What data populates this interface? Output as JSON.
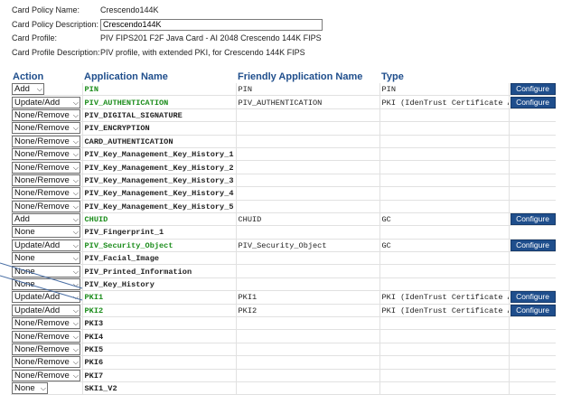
{
  "policy": {
    "name_label": "Card Policy Name:",
    "name_value": "Crescendo144K",
    "desc_label": "Card Policy Description:",
    "desc_value": "Crescendo144K",
    "profile_label": "Card Profile:",
    "profile_value": "PIV FIPS201 F2F Java Card - AI 2048 Crescendo 144K FIPS",
    "profile_desc_label": "Card Profile Description:",
    "profile_desc_value": "PIV profile, with extended PKI, for Crescendo 144K FIPS"
  },
  "table": {
    "headers": {
      "action": "Action",
      "app_name": "Application Name",
      "friendly": "Friendly Application Name",
      "type": "Type"
    },
    "configure_label": "Configure",
    "rows": [
      {
        "action": "Add",
        "name": "PIN",
        "green": true,
        "friendly": "PIN",
        "type": "PIN",
        "configure": true
      },
      {
        "action": "Update/Add",
        "name": "PIV_AUTHENTICATION",
        "green": true,
        "friendly": "PIV_AUTHENTICATION",
        "type": "PKI (IdenTrust Certificate Authority)",
        "configure": true
      },
      {
        "action": "None/Remove",
        "name": "PIV_DIGITAL_SIGNATURE",
        "green": false,
        "friendly": "",
        "type": "",
        "configure": false
      },
      {
        "action": "None/Remove",
        "name": "PIV_ENCRYPTION",
        "green": false,
        "friendly": "",
        "type": "",
        "configure": false
      },
      {
        "action": "None/Remove",
        "name": "CARD_AUTHENTICATION",
        "green": false,
        "friendly": "",
        "type": "",
        "configure": false
      },
      {
        "action": "None/Remove",
        "name": "PIV_Key_Management_Key_History_1",
        "green": false,
        "friendly": "",
        "type": "",
        "configure": false
      },
      {
        "action": "None/Remove",
        "name": "PIV_Key_Management_Key_History_2",
        "green": false,
        "friendly": "",
        "type": "",
        "configure": false
      },
      {
        "action": "None/Remove",
        "name": "PIV_Key_Management_Key_History_3",
        "green": false,
        "friendly": "",
        "type": "",
        "configure": false
      },
      {
        "action": "None/Remove",
        "name": "PIV_Key_Management_Key_History_4",
        "green": false,
        "friendly": "",
        "type": "",
        "configure": false
      },
      {
        "action": "None/Remove",
        "name": "PIV_Key_Management_Key_History_5",
        "green": false,
        "friendly": "",
        "type": "",
        "configure": false
      },
      {
        "action": "Add",
        "name": "CHUID",
        "green": true,
        "friendly": "CHUID",
        "type": "GC",
        "configure": true
      },
      {
        "action": "None",
        "name": "PIV_Fingerprint_1",
        "green": false,
        "friendly": "",
        "type": "",
        "configure": false
      },
      {
        "action": "Update/Add",
        "name": "PIV_Security_Object",
        "green": true,
        "friendly": "PIV_Security_Object",
        "type": "GC",
        "configure": true
      },
      {
        "action": "None",
        "name": "PIV_Facial_Image",
        "green": false,
        "friendly": "",
        "type": "",
        "configure": false
      },
      {
        "action": "None",
        "name": "PIV_Printed_Information",
        "green": false,
        "friendly": "",
        "type": "",
        "configure": false
      },
      {
        "action": "None",
        "name": "PIV_Key_History",
        "green": false,
        "friendly": "",
        "type": "",
        "configure": false
      },
      {
        "action": "Update/Add",
        "name": "PKI1",
        "green": true,
        "friendly": "PKI1",
        "type": "PKI (IdenTrust Certificate Authority)",
        "configure": true
      },
      {
        "action": "Update/Add",
        "name": "PKI2",
        "green": true,
        "friendly": "PKI2",
        "type": "PKI (IdenTrust Certificate Authority)",
        "configure": true
      },
      {
        "action": "None/Remove",
        "name": "PKI3",
        "green": false,
        "friendly": "",
        "type": "",
        "configure": false
      },
      {
        "action": "None/Remove",
        "name": "PKI4",
        "green": false,
        "friendly": "",
        "type": "",
        "configure": false
      },
      {
        "action": "None/Remove",
        "name": "PKI5",
        "green": false,
        "friendly": "",
        "type": "",
        "configure": false
      },
      {
        "action": "None/Remove",
        "name": "PKI6",
        "green": false,
        "friendly": "",
        "type": "",
        "configure": false
      },
      {
        "action": "None/Remove",
        "name": "PKI7",
        "green": false,
        "friendly": "",
        "type": "",
        "configure": false
      },
      {
        "action": "None",
        "name": "SKI1_V2",
        "green": false,
        "friendly": "",
        "type": "",
        "configure": false
      }
    ]
  },
  "colors": {
    "header_text": "#1f4e8c",
    "green_name": "#1a8c1a",
    "configure_bg": "#1f4e8c",
    "annotation_line": "#4a6fa5"
  },
  "icons": {
    "dropdown": "chevron-down-icon"
  }
}
